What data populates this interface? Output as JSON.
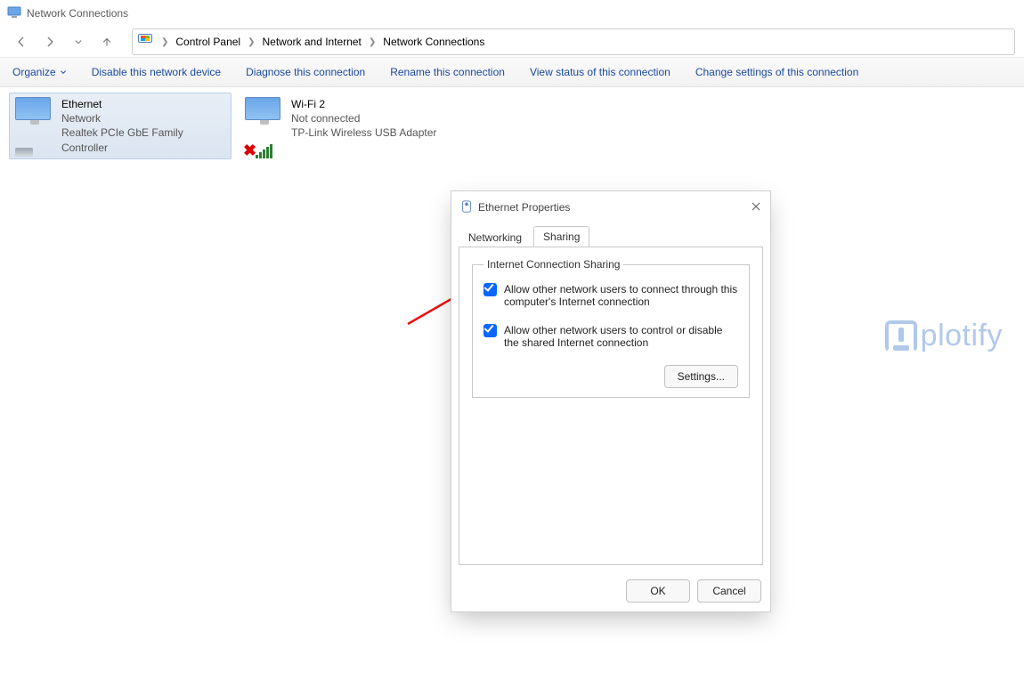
{
  "window": {
    "title": "Network Connections"
  },
  "breadcrumb": {
    "items": [
      "Control Panel",
      "Network and Internet",
      "Network Connections"
    ]
  },
  "toolbar": {
    "organize": "Organize",
    "disable": "Disable this network device",
    "diagnose": "Diagnose this connection",
    "rename": "Rename this connection",
    "view_status": "View status of this connection",
    "change_settings": "Change settings of this connection"
  },
  "adapters": [
    {
      "name": "Ethernet",
      "status": "Network",
      "device": "Realtek PCIe GbE Family Controller",
      "selected": true,
      "disconnected": false
    },
    {
      "name": "Wi-Fi 2",
      "status": "Not connected",
      "device": "TP-Link Wireless USB Adapter",
      "selected": false,
      "disconnected": true
    }
  ],
  "dialog": {
    "title": "Ethernet Properties",
    "tabs": {
      "networking": "Networking",
      "sharing": "Sharing"
    },
    "group_label": "Internet Connection Sharing",
    "check1": "Allow other network users to connect through this computer's Internet connection",
    "check2": "Allow other network users to control or disable the shared Internet connection",
    "settings_btn": "Settings...",
    "ok": "OK",
    "cancel": "Cancel"
  },
  "watermark": {
    "text": "plotify"
  }
}
